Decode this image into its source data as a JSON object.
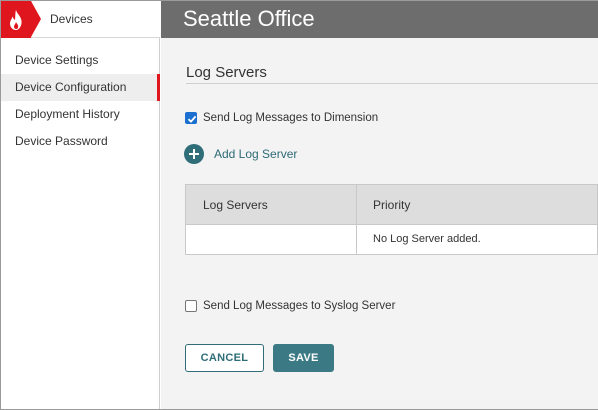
{
  "app": {
    "section": "Devices",
    "brand_color": "#e0161e",
    "logo_icon": "flame-icon"
  },
  "sidebar": {
    "items": [
      {
        "label": "Device Settings",
        "active": false
      },
      {
        "label": "Device Configuration",
        "active": true
      },
      {
        "label": "Deployment History",
        "active": false
      },
      {
        "label": "Device Password",
        "active": false
      }
    ]
  },
  "header": {
    "title": "Seattle Office"
  },
  "log_servers": {
    "section_title": "Log Servers",
    "send_to_dimension": {
      "label": "Send Log Messages to Dimension",
      "checked": true
    },
    "add_button": {
      "label": "Add Log Server",
      "icon": "plus-circle-icon"
    },
    "table": {
      "columns": [
        "Log Servers",
        "Priority"
      ],
      "empty_message": "No Log Server added."
    },
    "send_to_syslog": {
      "label": "Send Log Messages to Syslog Server",
      "checked": false
    }
  },
  "actions": {
    "cancel_label": "CANCEL",
    "save_label": "SAVE",
    "accent_color": "#3b7a84"
  }
}
